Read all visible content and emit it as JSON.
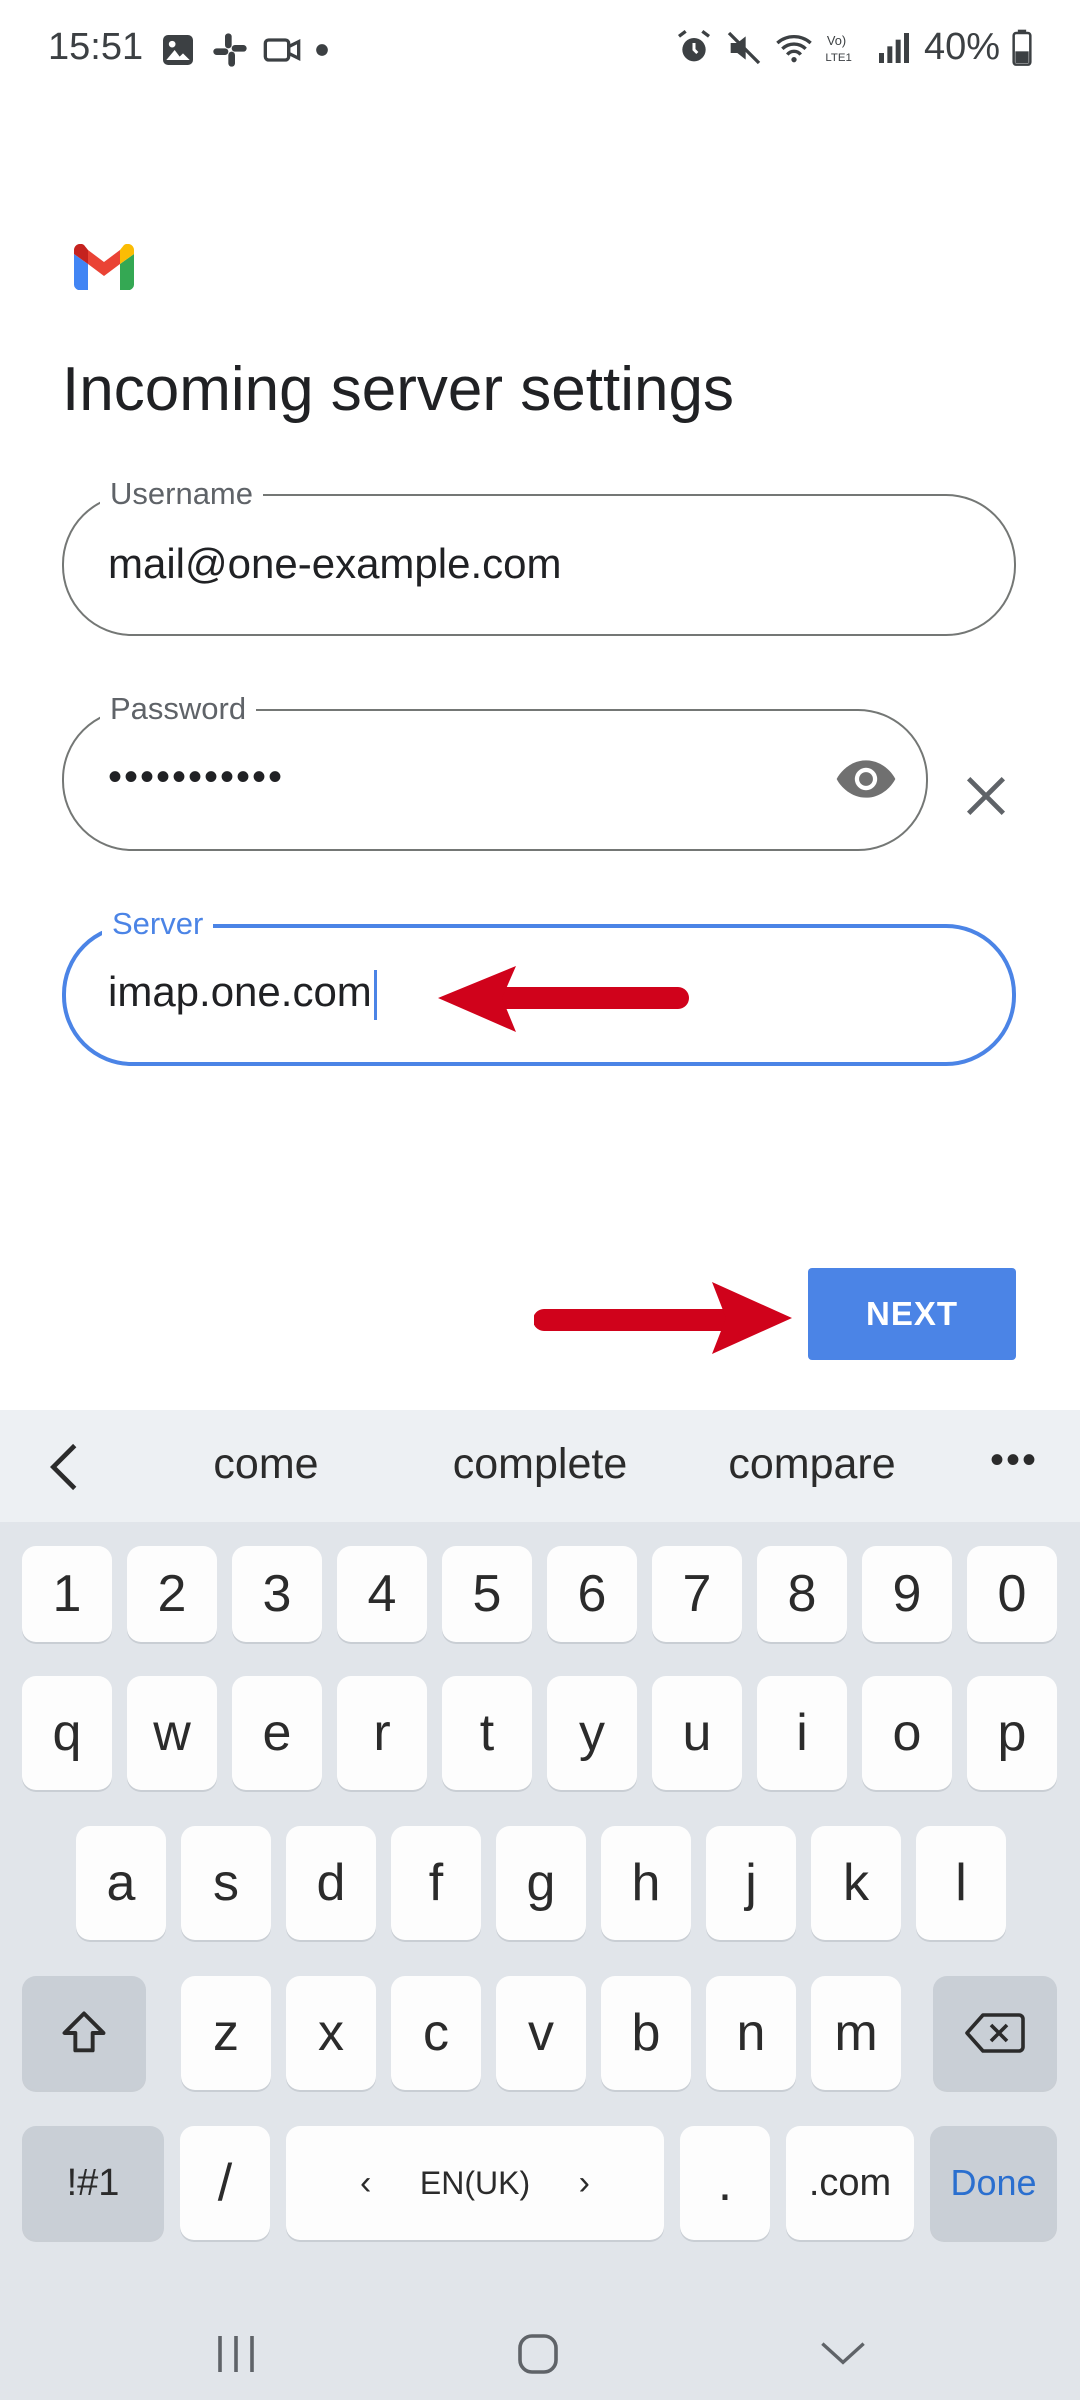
{
  "status_bar": {
    "time": "15:51",
    "battery": "40%",
    "left_icons": [
      "gallery-icon",
      "slack-icon",
      "video-icon",
      "dot-icon"
    ],
    "right_icons": [
      "alarm-icon",
      "mute-icon",
      "wifi-icon",
      "volte-icon",
      "signal-icon",
      "battery-icon"
    ]
  },
  "page": {
    "title": "Incoming server settings"
  },
  "form": {
    "username": {
      "label": "Username",
      "value": "mail@one-example.com"
    },
    "password": {
      "label": "Password",
      "masked_value": "•••••••••••"
    },
    "server": {
      "label": "Server",
      "value": "imap.one.com"
    }
  },
  "next_button": {
    "label": "NEXT"
  },
  "colors": {
    "accent": "#4b84e6",
    "arrow": "#d0021b",
    "keyboard_bg": "#e1e5ea"
  },
  "keyboard": {
    "suggestions": [
      "come",
      "complete",
      "compare"
    ],
    "more": "•••",
    "row_numbers": [
      "1",
      "2",
      "3",
      "4",
      "5",
      "6",
      "7",
      "8",
      "9",
      "0"
    ],
    "row_1": [
      "q",
      "w",
      "e",
      "r",
      "t",
      "y",
      "u",
      "i",
      "o",
      "p"
    ],
    "row_2": [
      "a",
      "s",
      "d",
      "f",
      "g",
      "h",
      "j",
      "k",
      "l"
    ],
    "row_3": [
      "z",
      "x",
      "c",
      "v",
      "b",
      "n",
      "m"
    ],
    "symbols_key": "!#1",
    "slash_key": "/",
    "space_label": "EN(UK)",
    "period_key": ".",
    "dotcom_key": ".com",
    "done_key": "Done"
  }
}
